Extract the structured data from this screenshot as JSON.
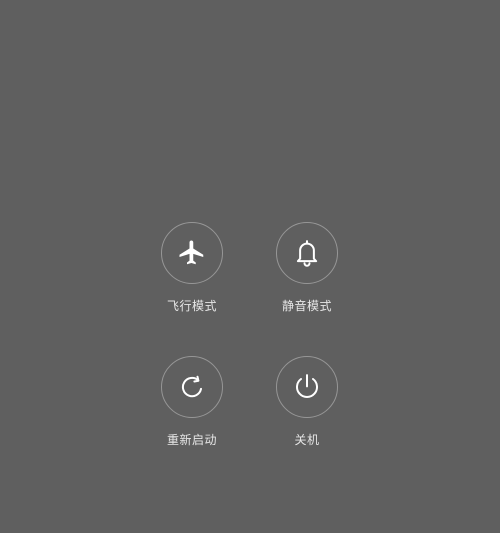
{
  "power_menu": {
    "options": [
      {
        "label": "飞行模式",
        "icon": "airplane-icon"
      },
      {
        "label": "静音模式",
        "icon": "bell-icon"
      },
      {
        "label": "重新启动",
        "icon": "restart-icon"
      },
      {
        "label": "关机",
        "icon": "power-icon"
      }
    ]
  },
  "colors": {
    "background": "#5f5f5f",
    "icon": "#ffffff",
    "label": "#e6e6e6",
    "ring": "rgba(255,255,255,0.35)"
  }
}
